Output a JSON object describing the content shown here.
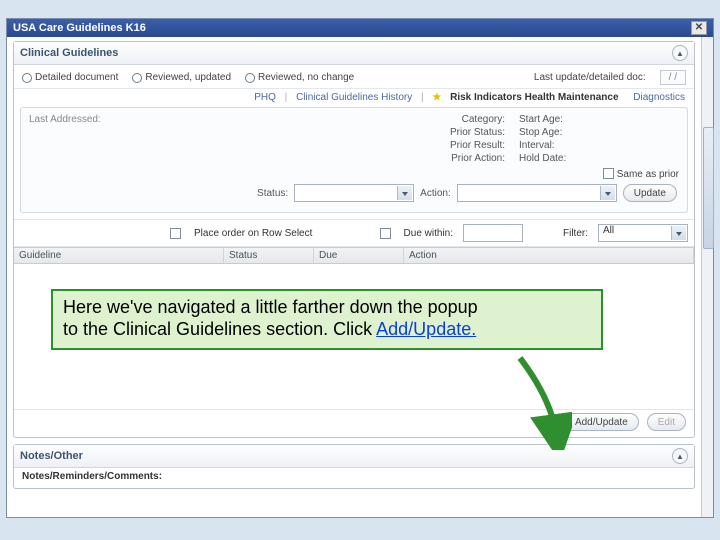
{
  "title": "USA Care Guidelines K16",
  "clinical": {
    "heading": "Clinical Guidelines",
    "radios": {
      "detailed": "Detailed document",
      "updated": "Reviewed, updated",
      "nochange": "Reviewed, no change"
    },
    "last_update_label": "Last update/detailed doc:",
    "last_update_value": "/ /",
    "tabs": {
      "phq": "PHQ",
      "history": "Clinical Guidelines History",
      "risk": "Risk Indicators Health Maintenance",
      "diag": "Diagnostics"
    },
    "fields": {
      "last_addressed": "Last Addressed:",
      "category": "Category:",
      "prior_status": "Prior Status:",
      "prior_result": "Prior Result:",
      "prior_action": "Prior Action:",
      "start_age": "Start Age:",
      "stop_age": "Stop Age:",
      "interval": "Interval:",
      "hold_date": "Hold Date:"
    },
    "same_as_prior": "Same as prior",
    "status_label": "Status:",
    "action_label": "Action:",
    "update_btn": "Update",
    "place_order": "Place order on Row Select",
    "due_within": "Due within:",
    "filter_label": "Filter:",
    "filter_value": "All",
    "columns": {
      "guideline": "Guideline",
      "status": "Status",
      "due": "Due",
      "action": "Action"
    },
    "add_update": "Add/Update",
    "edit_btn": "Edit"
  },
  "notes": {
    "heading": "Notes/Other",
    "sub": "Notes/Reminders/Comments:"
  },
  "callout": {
    "line1": "Here we've navigated a little farther down the popup",
    "line2a": "to the Clinical Guidelines section.  Click ",
    "line2b": "Add/Update."
  }
}
